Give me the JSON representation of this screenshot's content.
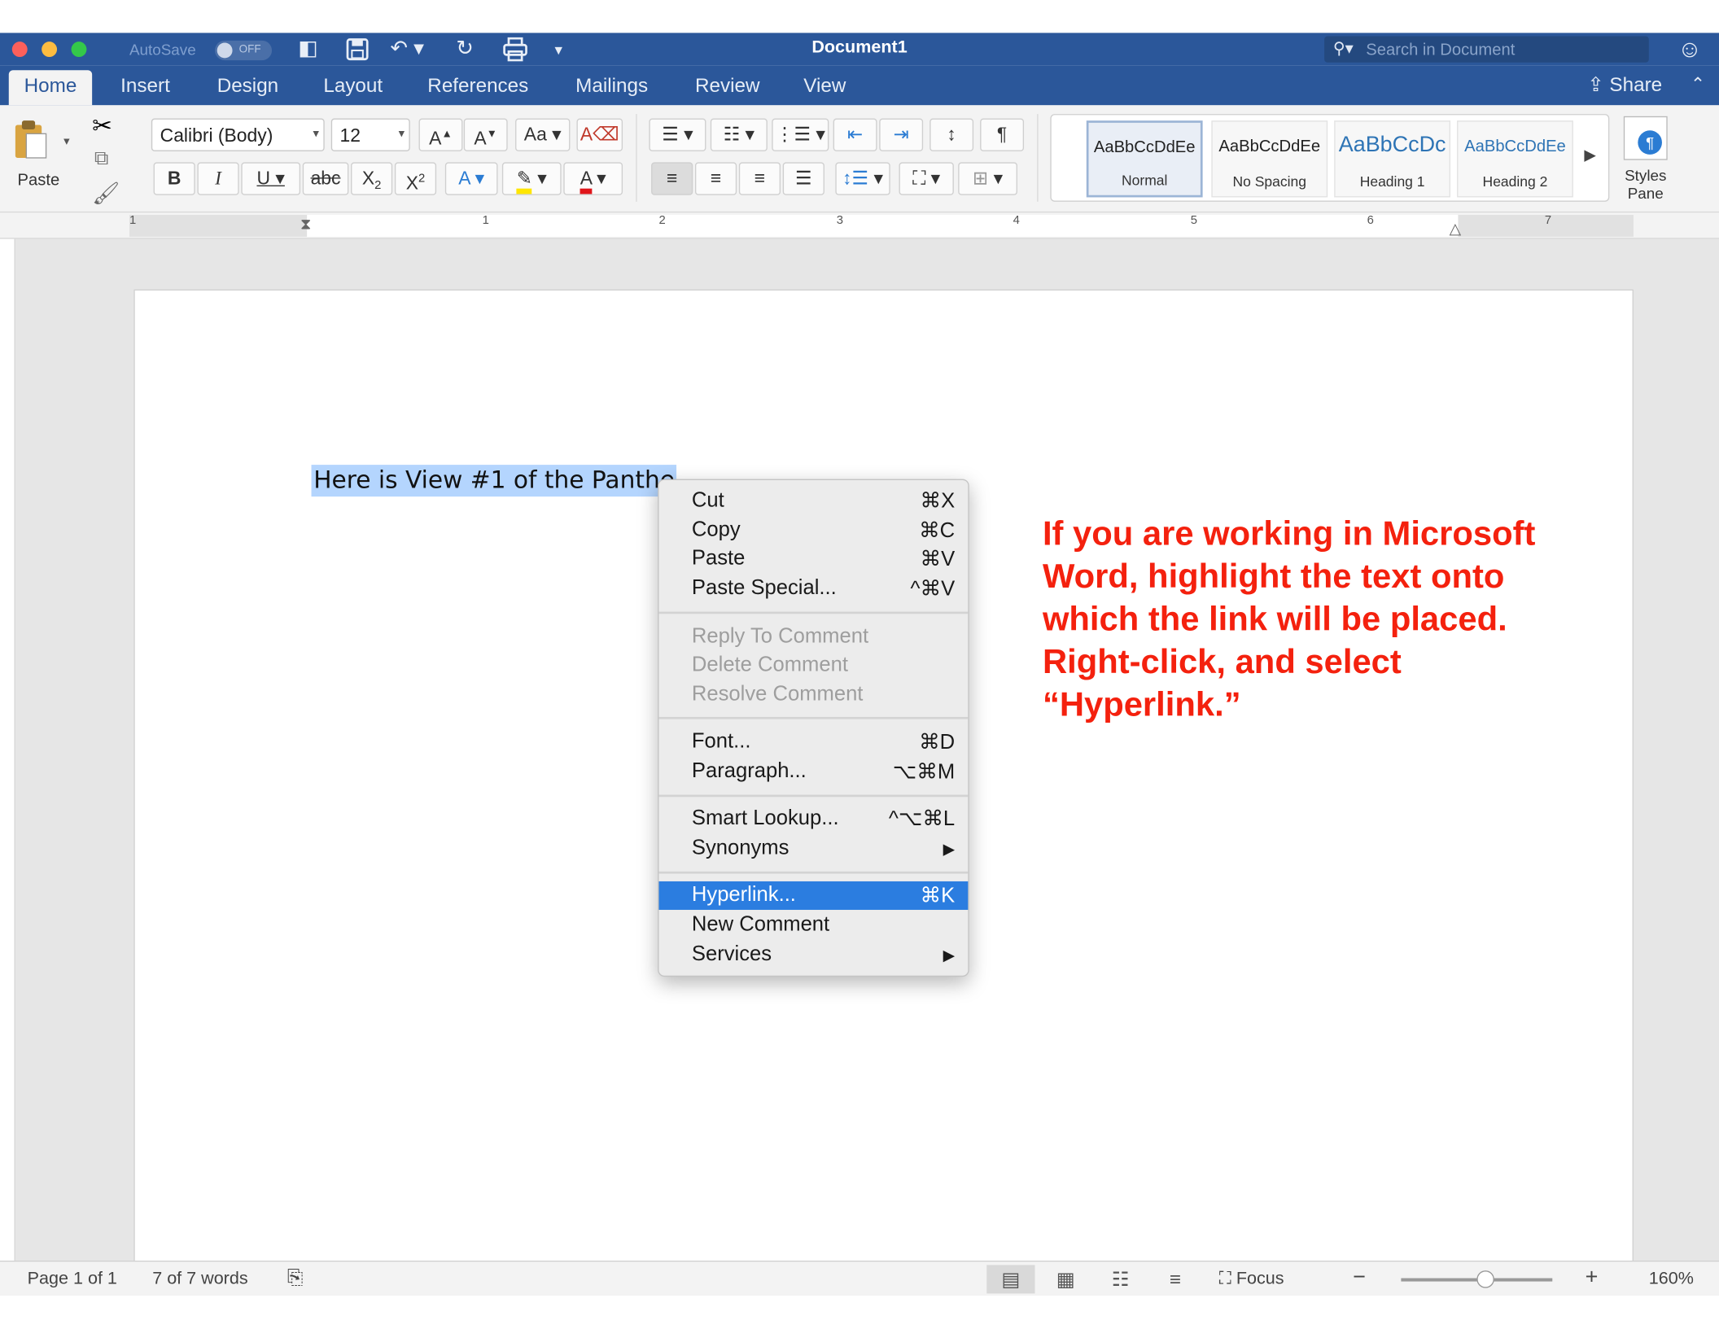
{
  "window": {
    "title": "Document1",
    "autosave_label": "AutoSave",
    "autosave_state": "OFF",
    "search_placeholder": "Search in Document"
  },
  "tabs": [
    {
      "label": "Home",
      "active": true
    },
    {
      "label": "Insert"
    },
    {
      "label": "Design"
    },
    {
      "label": "Layout"
    },
    {
      "label": "References"
    },
    {
      "label": "Mailings"
    },
    {
      "label": "Review"
    },
    {
      "label": "View"
    }
  ],
  "share_label": "Share",
  "ribbon": {
    "paste_label": "Paste",
    "font_name": "Calibri (Body)",
    "font_size": "12",
    "grow_font": "A",
    "shrink_font": "A",
    "change_case": "Aa",
    "bold": "B",
    "italic": "I",
    "underline": "U",
    "strikethrough": "abc",
    "subscript": "X",
    "subscript_sub": "2",
    "superscript": "X",
    "superscript_sup": "2",
    "text_effects": "A",
    "font_color": "A",
    "pilcrow": "¶",
    "styles": [
      {
        "sample": "AaBbCcDdEe",
        "name": "Normal",
        "selected": true
      },
      {
        "sample": "AaBbCcDdEe",
        "name": "No Spacing"
      },
      {
        "sample": "AaBbCcDc",
        "name": "Heading 1"
      },
      {
        "sample": "AaBbCcDdEe",
        "name": "Heading 2"
      }
    ],
    "styles_pane_label_1": "Styles",
    "styles_pane_label_2": "Pane"
  },
  "ruler_numbers": [
    "1",
    "1",
    "2",
    "3",
    "4",
    "5",
    "6",
    "7"
  ],
  "document": {
    "selected_text": "Here is View #1 of the Panthe",
    "instruction_note": "If you are working in Microsoft Word, highlight the text onto which the link will be placed. Right-click, and select “Hyperlink.”"
  },
  "context_menu": [
    {
      "label": "Cut",
      "shortcut": "⌘X"
    },
    {
      "label": "Copy",
      "shortcut": "⌘C"
    },
    {
      "label": "Paste",
      "shortcut": "⌘V"
    },
    {
      "label": "Paste Special...",
      "shortcut": "^⌘V"
    },
    {
      "label": "Reply To Comment",
      "shortcut": "",
      "disabled": true
    },
    {
      "label": "Delete Comment",
      "shortcut": "",
      "disabled": true
    },
    {
      "label": "Resolve Comment",
      "shortcut": "",
      "disabled": true
    },
    {
      "label": "Font...",
      "shortcut": "⌘D"
    },
    {
      "label": "Paragraph...",
      "shortcut": "⌥⌘M"
    },
    {
      "label": "Smart Lookup...",
      "shortcut": "^⌥⌘L"
    },
    {
      "label": "Synonyms",
      "shortcut": "▶"
    },
    {
      "label": "Hyperlink...",
      "shortcut": "⌘K",
      "highlighted": true
    },
    {
      "label": "New Comment",
      "shortcut": ""
    },
    {
      "label": "Services",
      "shortcut": "▶"
    }
  ],
  "status": {
    "page": "Page 1 of 1",
    "words": "7 of 7 words",
    "focus_label": "Focus",
    "zoom_minus": "−",
    "zoom_plus": "+",
    "zoom": "160%"
  },
  "colors": {
    "title_blue": "#2b579a",
    "note_red": "#f4210e",
    "menu_highlight": "#2b7de0",
    "selection": "#b4d5fe"
  }
}
